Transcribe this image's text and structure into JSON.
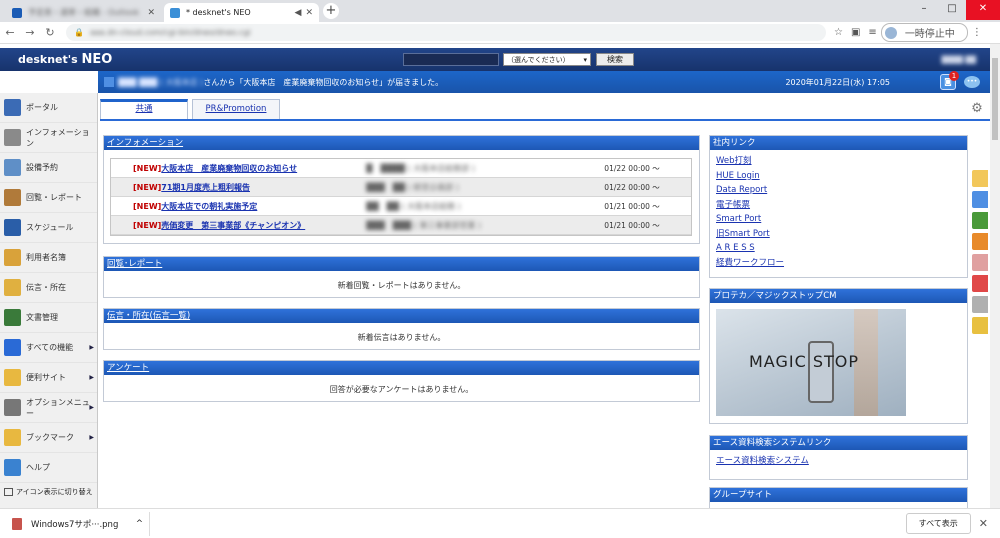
{
  "browser": {
    "tabs": [
      {
        "title": "予定表・週単・組織 - Outlook",
        "active": false
      },
      {
        "title": "* desknet's NEO",
        "active": true
      }
    ],
    "new_tab": "+",
    "url": "aaa.dn-cloud.com/cgi-bin/dneo/dneo.cgi",
    "profile_label": "一時停止中",
    "window_controls": [
      "–",
      "□",
      "✕"
    ]
  },
  "app": {
    "logo_prefix": "desknet's",
    "logo_main": "NEO",
    "search_placeholder": "",
    "search_select": "（選んでください）",
    "search_button": "検索",
    "header_user": "████ ██",
    "notice_sender": "███ ███ ( 大阪本店 )",
    "notice_text": "さんから「大阪本店　産業廃棄物回収のお知らせ」が届きました。",
    "notice_datetime": "2020年01月22日(水) 17:05",
    "notice_badge": "1"
  },
  "sidebar": {
    "items": [
      {
        "label": "ポータル",
        "icon": "portal-icon",
        "color": "#3b6bb5",
        "arrow": false
      },
      {
        "label": "インフォメーション",
        "icon": "information-icon",
        "color": "#8a8a8a",
        "arrow": false
      },
      {
        "label": "設備予約",
        "icon": "facility-icon",
        "color": "#5f8fc7",
        "arrow": false
      },
      {
        "label": "回覧・レポート",
        "icon": "report-icon",
        "color": "#b07a3a",
        "arrow": false
      },
      {
        "label": "スケジュール",
        "icon": "calendar-icon",
        "color": "#2a5ea8",
        "arrow": false
      },
      {
        "label": "利用者名簿",
        "icon": "address-book-icon",
        "color": "#d9a23a",
        "arrow": false
      },
      {
        "label": "伝言・所在",
        "icon": "memo-icon",
        "color": "#e0b040",
        "arrow": false
      },
      {
        "label": "文書管理",
        "icon": "document-icon",
        "color": "#3a7a3a",
        "arrow": false
      },
      {
        "label": "すべての機能",
        "icon": "neo-icon",
        "color": "#2a6ad6",
        "arrow": true
      },
      {
        "label": "便利サイト",
        "icon": "folder-icon",
        "color": "#e8b840",
        "arrow": true
      },
      {
        "label": "オプションメニュー",
        "icon": "folder-gray-icon",
        "color": "#777777",
        "arrow": true
      },
      {
        "label": "ブックマーク",
        "icon": "folder-icon",
        "color": "#e8b840",
        "arrow": true
      },
      {
        "label": "ヘルプ",
        "icon": "help-icon",
        "color": "#3a82d0",
        "arrow": false
      }
    ],
    "toggle_label": "アイコン表示に切り替え"
  },
  "portal_tabs": [
    "共通",
    "PR&Promotion"
  ],
  "information": {
    "title": "インフォメーション",
    "rows": [
      {
        "tag": "[NEW]",
        "title": "大阪本店　産業廃棄物回収のお知らせ",
        "author": "█　████ ( 大阪本店総務部 )",
        "date": "01/22 00:00 ～"
      },
      {
        "tag": "[NEW]",
        "title": "71期1月度売上粗利報告",
        "author": "███　██ ( 経営企画部 )",
        "date": "01/22 00:00 ～"
      },
      {
        "tag": "[NEW]",
        "title": "大阪本店での朝礼実施予定",
        "author": "██　██ ( 大阪本店総務 )",
        "date": "01/21 00:00 ～"
      },
      {
        "tag": "[NEW]",
        "title": "売価変更　第三事業部《チャンピオン》",
        "author": "███　███ ( 第三事業部営業 )",
        "date": "01/21 00:00 ～"
      }
    ]
  },
  "circulation": {
    "title": "回覧･レポート",
    "empty": "新着回覧・レポートはありません。"
  },
  "messages": {
    "title": "伝言・所在(伝言一覧)",
    "empty": "新着伝言はありません。"
  },
  "survey": {
    "title": "アンケート",
    "empty": "回答が必要なアンケートはありません。"
  },
  "internal_links": {
    "title": "社内リンク",
    "links": [
      "Web打刻",
      "HUE Login",
      "Data Report",
      "電子帳票",
      "Smart Port",
      "旧Smart Port",
      "A R E S S",
      "経費ワークフロー"
    ]
  },
  "promo": {
    "title": "プロテカ／マジックストップCM",
    "image_text": "MAGIC STOP"
  },
  "ace_links": {
    "title": "エース資料検索システムリンク",
    "link": "エース資料検索システム"
  },
  "group_site": {
    "title": "グループサイト"
  },
  "side_palette": [
    "#f2c75a",
    "#4f8fe3",
    "#4a9a3a",
    "#e88a2a",
    "#e0a0a0",
    "#e04848",
    "#b0b0b0",
    "#e8c040"
  ],
  "downloads": {
    "file": "Windows7サポ···.png",
    "show_all": "すべて表示"
  }
}
